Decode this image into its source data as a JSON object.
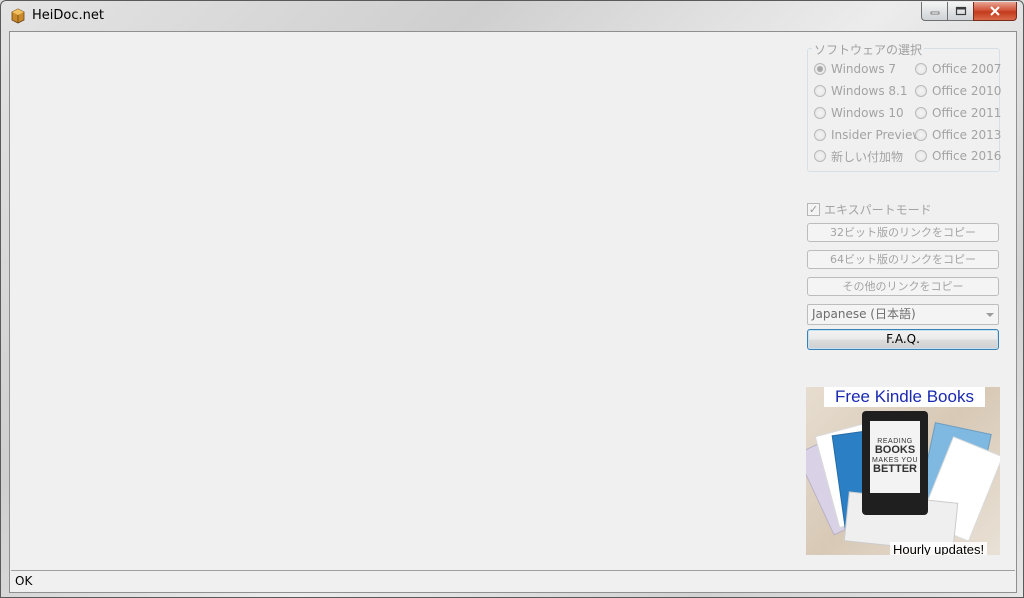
{
  "window": {
    "title": "HeiDoc.net"
  },
  "software_group": {
    "legend": "ソフトウェアの選択",
    "options_left": [
      {
        "label": "Windows 7",
        "checked": true
      },
      {
        "label": "Windows 8.1",
        "checked": false
      },
      {
        "label": "Windows 10",
        "checked": false
      },
      {
        "label": "Insider Preview",
        "checked": false
      },
      {
        "label": "新しい付加物",
        "checked": false
      }
    ],
    "options_right": [
      {
        "label": "Office 2007",
        "checked": false
      },
      {
        "label": "Office 2010",
        "checked": false
      },
      {
        "label": "Office 2011",
        "checked": false
      },
      {
        "label": "Office 2013",
        "checked": false
      },
      {
        "label": "Office 2016",
        "checked": false
      }
    ]
  },
  "expert_mode": {
    "label": "エキスパートモード",
    "checked": true
  },
  "buttons": {
    "copy32": "32ビット版のリンクをコピー",
    "copy64": "64ビット版のリンクをコピー",
    "copy_other": "その他のリンクをコピー",
    "faq": "F.A.Q."
  },
  "language_select": {
    "value": "Japanese (日本語)"
  },
  "banner": {
    "title": "Free Kindle Books",
    "screen_line1": "READING",
    "screen_line2": "BOOKS",
    "screen_line3": "MAKES YOU",
    "screen_line4": "BETTER",
    "footer": "Hourly updates!"
  },
  "status": {
    "text": "OK"
  },
  "colors": {
    "disabled_text": "#a3a3a3",
    "banner_title": "#1a2ab0",
    "close_button": "#c23a1c",
    "focus_border": "#3c7fb1"
  }
}
